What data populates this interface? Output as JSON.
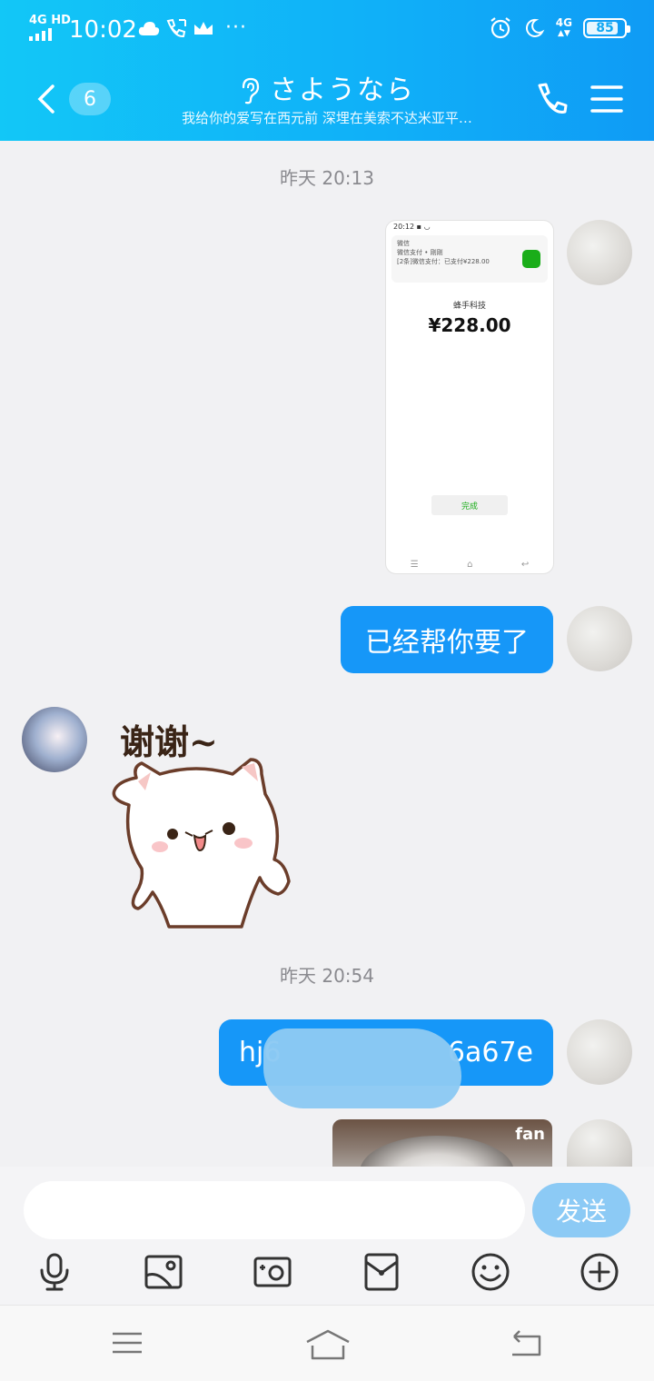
{
  "status_bar": {
    "network": "4G HD",
    "time": "10:02",
    "right_network": "4G",
    "battery": "85",
    "battery_level": 0.85
  },
  "header": {
    "unread_count": "6",
    "title": "さようなら",
    "subtitle": "我给你的爱写在西元前 深埋在美索不达米亚平…"
  },
  "messages": {
    "timestamp1": "昨天 20:13",
    "screenshot": {
      "merchant": "蜂手科技",
      "amount": "¥228.00",
      "card_title": "微信",
      "card_line1": "微信支付 • 刚刚",
      "card_line2": "[2条]微信支付：已支付¥228.00",
      "done_label": "完成"
    },
    "text1": "已经帮你要了",
    "sticker_text": "谢谢~",
    "timestamp2": "昨天 20:54",
    "text2_start": "hj6",
    "text2_end": "6a67e",
    "photo_watermark": "fan"
  },
  "input": {
    "placeholder": "",
    "send_label": "发送"
  },
  "toolbar": [
    "mic-icon",
    "image-icon",
    "camera-icon",
    "red-packet-icon",
    "emoji-icon",
    "plus-icon"
  ]
}
